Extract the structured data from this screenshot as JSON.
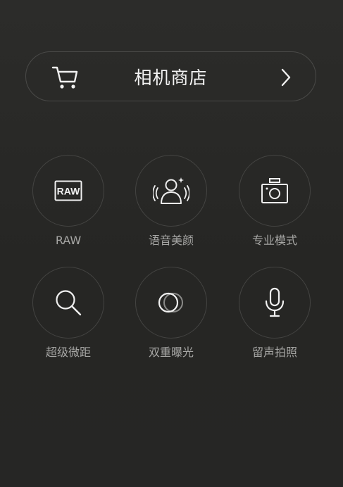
{
  "store": {
    "title": "相机商店",
    "cart_icon": "shopping-cart-icon",
    "arrow_icon": "chevron-right-icon"
  },
  "features": [
    {
      "label": "RAW",
      "icon": "raw-icon",
      "icon_text": "RAW"
    },
    {
      "label": "语音美颜",
      "icon": "voice-beauty-icon"
    },
    {
      "label": "专业模式",
      "icon": "pro-camera-icon"
    },
    {
      "label": "超级微距",
      "icon": "magnifier-icon"
    },
    {
      "label": "双重曝光",
      "icon": "double-exposure-icon"
    },
    {
      "label": "留声拍照",
      "icon": "microphone-icon"
    }
  ],
  "colors": {
    "background": "#2a2a28",
    "border": "#4a4a48",
    "title_text": "#f2f2f2",
    "label_text": "#a6a6a4",
    "icon_stroke": "#f0f0f0"
  }
}
